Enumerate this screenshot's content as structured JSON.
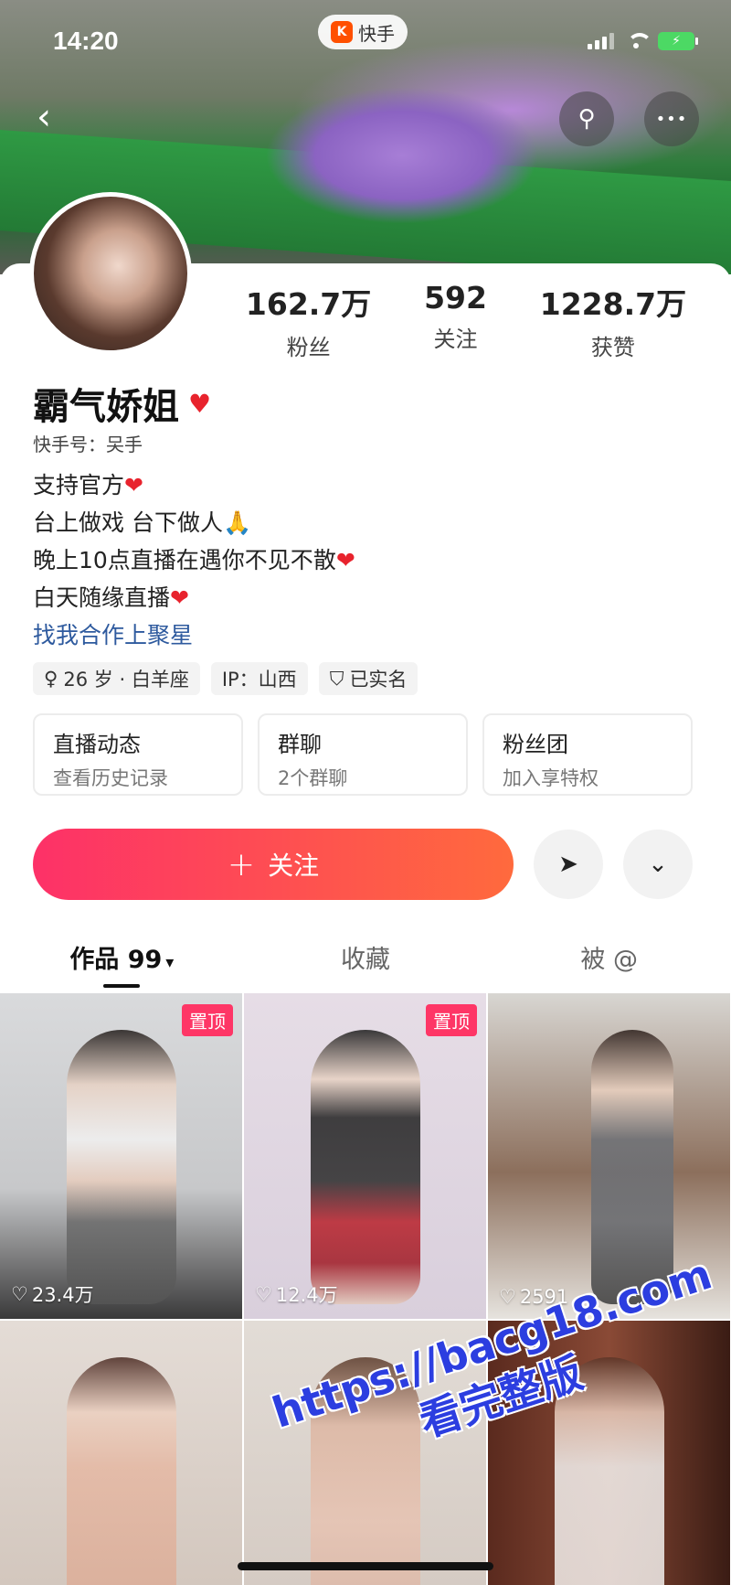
{
  "status_bar": {
    "time": "14:20",
    "app_name": "快手",
    "app_logo": "K"
  },
  "header": {
    "back_icon": "‹",
    "search_icon": "⚲",
    "more_icon": "•••"
  },
  "profile": {
    "stats": [
      {
        "num": "162.7万",
        "label": "粉丝"
      },
      {
        "num": "592",
        "label": "关注"
      },
      {
        "num": "1228.7万",
        "label": "获赞"
      }
    ],
    "name": "霸气娇姐",
    "name_badge": "♥",
    "kuaishou_id": "快手号：㕦手",
    "bio": [
      "支持官方",
      "台上做戏  台下做人🙏",
      "晚上10点直播在遇你不见不散",
      "白天随缘直播"
    ],
    "bio_hearts": [
      "❤",
      "",
      "❤",
      "❤"
    ],
    "bio_link": "找我合作上聚星",
    "tags": [
      {
        "icon": "♀",
        "text": "26 岁 · 白羊座"
      },
      {
        "icon": "",
        "text": "IP：山西"
      },
      {
        "icon": "⛉",
        "text": "已实名"
      }
    ],
    "boxes": [
      {
        "title": "直播动态",
        "sub": "查看历史记录"
      },
      {
        "title": "群聊",
        "sub": "2个群聊"
      },
      {
        "title": "粉丝团",
        "sub": "加入享特权"
      }
    ],
    "follow_label": "关注",
    "follow_plus": "+",
    "share_icon": "➤",
    "expand_icon": "⌄"
  },
  "tabs": [
    {
      "label": "作品 99",
      "caret": "▾"
    },
    {
      "label": "收藏",
      "caret": ""
    },
    {
      "label": "被 @",
      "caret": ""
    }
  ],
  "grid": [
    {
      "pin": "置顶",
      "likes": "23.4万"
    },
    {
      "pin": "置顶",
      "likes": "12.4万"
    },
    {
      "pin": "",
      "likes": "2591"
    },
    {
      "pin": "",
      "likes": ""
    },
    {
      "pin": "",
      "likes": ""
    },
    {
      "pin": "",
      "likes": ""
    }
  ],
  "watermark": {
    "url": "https://bacg18.com",
    "text": "看完整版"
  },
  "colors": {
    "accent": "#fd3168",
    "link": "#2e5a9e",
    "heart": "#e8232d"
  }
}
